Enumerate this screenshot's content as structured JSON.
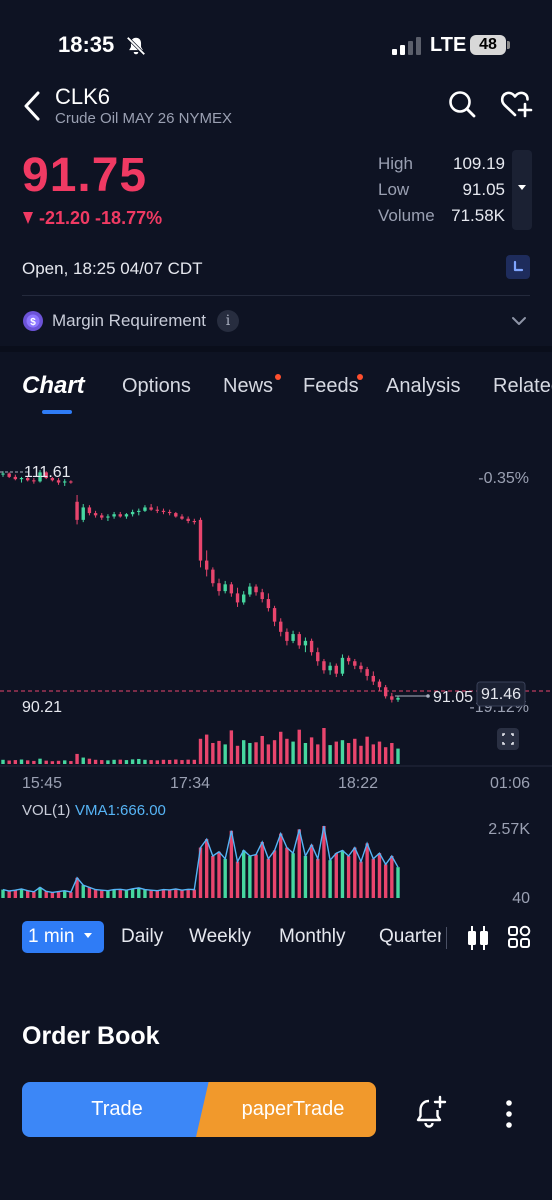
{
  "status_bar": {
    "time": "18:35",
    "network": "LTE",
    "battery": "48"
  },
  "header": {
    "symbol": "CLK6",
    "subtitle": "Crude Oil MAY 26 NYMEX"
  },
  "quote": {
    "price": "91.75",
    "change": "-21.20 -18.77%",
    "high_label": "High",
    "high": "109.19",
    "low_label": "Low",
    "low": "91.05",
    "volume_label": "Volume",
    "volume": "71.58K",
    "open_line": "Open, 18:25 04/07 CDT"
  },
  "margin": {
    "label": "Margin Requirement",
    "info": "i"
  },
  "tabs": [
    {
      "label": "Chart"
    },
    {
      "label": "Options"
    },
    {
      "label": "News"
    },
    {
      "label": "Feeds"
    },
    {
      "label": "Analysis"
    },
    {
      "label": "Related"
    }
  ],
  "colors": {
    "up": "#46d7a0",
    "down": "#e8456d",
    "accent": "#2f7cf6",
    "vma": "#56b4f5"
  },
  "chart_data": {
    "type": "candlestick",
    "price_range": [
      90.21,
      111.61
    ],
    "high_marker": "111.61",
    "low_marker": "91.05",
    "low_axis_label": "90.21",
    "last_price": "91.46",
    "pct_top": "-0.35%",
    "pct_bottom": "-19.12%",
    "x_ticks": [
      "15:45",
      "17:34",
      "18:22",
      "01:06"
    ],
    "volume_label": "VOL(1)",
    "vma_label": "VMA1:666.00",
    "volume_max": "2.57K",
    "volume_min": "40",
    "candles": [
      [
        111.2,
        111.5,
        111.0,
        111.3
      ],
      [
        111.3,
        111.4,
        110.9,
        111.0
      ],
      [
        111.0,
        111.2,
        110.7,
        110.8
      ],
      [
        110.8,
        111.0,
        110.5,
        110.9
      ],
      [
        110.9,
        111.1,
        110.6,
        110.7
      ],
      [
        110.7,
        110.9,
        110.4,
        110.6
      ],
      [
        110.6,
        111.6,
        110.5,
        111.4
      ],
      [
        111.4,
        111.5,
        110.8,
        110.9
      ],
      [
        110.9,
        111.0,
        110.6,
        110.7
      ],
      [
        110.7,
        110.9,
        110.3,
        110.5
      ],
      [
        110.5,
        110.8,
        110.2,
        110.6
      ],
      [
        110.6,
        110.7,
        110.4,
        110.5
      ],
      [
        108.8,
        109.4,
        106.8,
        107.2
      ],
      [
        107.2,
        108.6,
        107.0,
        108.3
      ],
      [
        108.3,
        108.5,
        107.6,
        107.8
      ],
      [
        107.8,
        108.0,
        107.4,
        107.6
      ],
      [
        107.6,
        107.8,
        107.2,
        107.4
      ],
      [
        107.4,
        107.7,
        107.1,
        107.5
      ],
      [
        107.5,
        107.9,
        107.3,
        107.7
      ],
      [
        107.7,
        107.9,
        107.4,
        107.5
      ],
      [
        107.5,
        107.8,
        107.3,
        107.7
      ],
      [
        107.7,
        108.1,
        107.5,
        107.9
      ],
      [
        107.9,
        108.2,
        107.6,
        108.0
      ],
      [
        108.0,
        108.5,
        107.9,
        108.3
      ],
      [
        108.3,
        108.6,
        108.0,
        108.1
      ],
      [
        108.1,
        108.4,
        107.8,
        108.0
      ],
      [
        108.0,
        108.2,
        107.7,
        107.9
      ],
      [
        107.9,
        108.1,
        107.6,
        107.8
      ],
      [
        107.8,
        107.9,
        107.4,
        107.5
      ],
      [
        107.5,
        107.7,
        107.2,
        107.3
      ],
      [
        107.3,
        107.5,
        106.9,
        107.1
      ],
      [
        107.1,
        107.3,
        106.8,
        107.0
      ],
      [
        107.2,
        107.4,
        103.0,
        103.6
      ],
      [
        103.6,
        104.5,
        102.2,
        102.8
      ],
      [
        102.8,
        103.0,
        101.3,
        101.6
      ],
      [
        101.6,
        102.0,
        100.5,
        100.9
      ],
      [
        100.9,
        101.8,
        100.7,
        101.5
      ],
      [
        101.5,
        101.7,
        100.4,
        100.7
      ],
      [
        100.7,
        101.2,
        99.5,
        99.9
      ],
      [
        99.9,
        100.9,
        99.7,
        100.6
      ],
      [
        100.6,
        101.6,
        100.4,
        101.3
      ],
      [
        101.3,
        101.5,
        100.5,
        100.8
      ],
      [
        100.8,
        101.1,
        99.9,
        100.2
      ],
      [
        100.2,
        100.7,
        99.1,
        99.4
      ],
      [
        99.4,
        99.6,
        97.8,
        98.2
      ],
      [
        98.2,
        98.5,
        96.9,
        97.3
      ],
      [
        97.3,
        97.6,
        96.1,
        96.5
      ],
      [
        96.5,
        97.4,
        96.3,
        97.1
      ],
      [
        97.1,
        97.3,
        95.8,
        96.1
      ],
      [
        96.1,
        96.8,
        95.5,
        96.5
      ],
      [
        96.5,
        96.7,
        95.2,
        95.5
      ],
      [
        95.5,
        95.9,
        94.3,
        94.7
      ],
      [
        94.7,
        94.9,
        93.6,
        93.9
      ],
      [
        93.9,
        94.6,
        93.5,
        94.3
      ],
      [
        94.3,
        94.5,
        93.3,
        93.6
      ],
      [
        93.6,
        95.3,
        93.4,
        95.0
      ],
      [
        95.0,
        95.2,
        94.4,
        94.7
      ],
      [
        94.7,
        94.9,
        94.0,
        94.3
      ],
      [
        94.3,
        94.6,
        93.7,
        94.0
      ],
      [
        94.0,
        94.2,
        93.0,
        93.4
      ],
      [
        93.4,
        93.8,
        92.6,
        92.9
      ],
      [
        92.9,
        93.1,
        92.1,
        92.4
      ],
      [
        92.4,
        92.6,
        91.4,
        91.6
      ],
      [
        91.6,
        91.9,
        91.05,
        91.3
      ],
      [
        91.3,
        91.6,
        91.1,
        91.46
      ]
    ],
    "volumes": [
      300,
      250,
      280,
      320,
      260,
      220,
      380,
      240,
      200,
      230,
      260,
      210,
      720,
      460,
      380,
      300,
      280,
      260,
      300,
      310,
      280,
      330,
      360,
      300,
      280,
      260,
      300,
      290,
      320,
      280,
      310,
      300,
      1800,
      2100,
      1500,
      1650,
      1400,
      2400,
      1300,
      1700,
      1500,
      1550,
      2000,
      1400,
      1700,
      2300,
      1800,
      1600,
      2450,
      1500,
      1900,
      1400,
      2570,
      1350,
      1600,
      1700,
      1500,
      1800,
      1300,
      1950,
      1400,
      1600,
      1200,
      1500,
      1100
    ]
  },
  "periods": {
    "active": "1 min",
    "items": [
      "Daily",
      "Weekly",
      "Monthly",
      "Quarterly"
    ]
  },
  "order_book": {
    "title": "Order Book"
  },
  "actions": {
    "trade": "Trade",
    "paper_trade": "paperTrade"
  }
}
